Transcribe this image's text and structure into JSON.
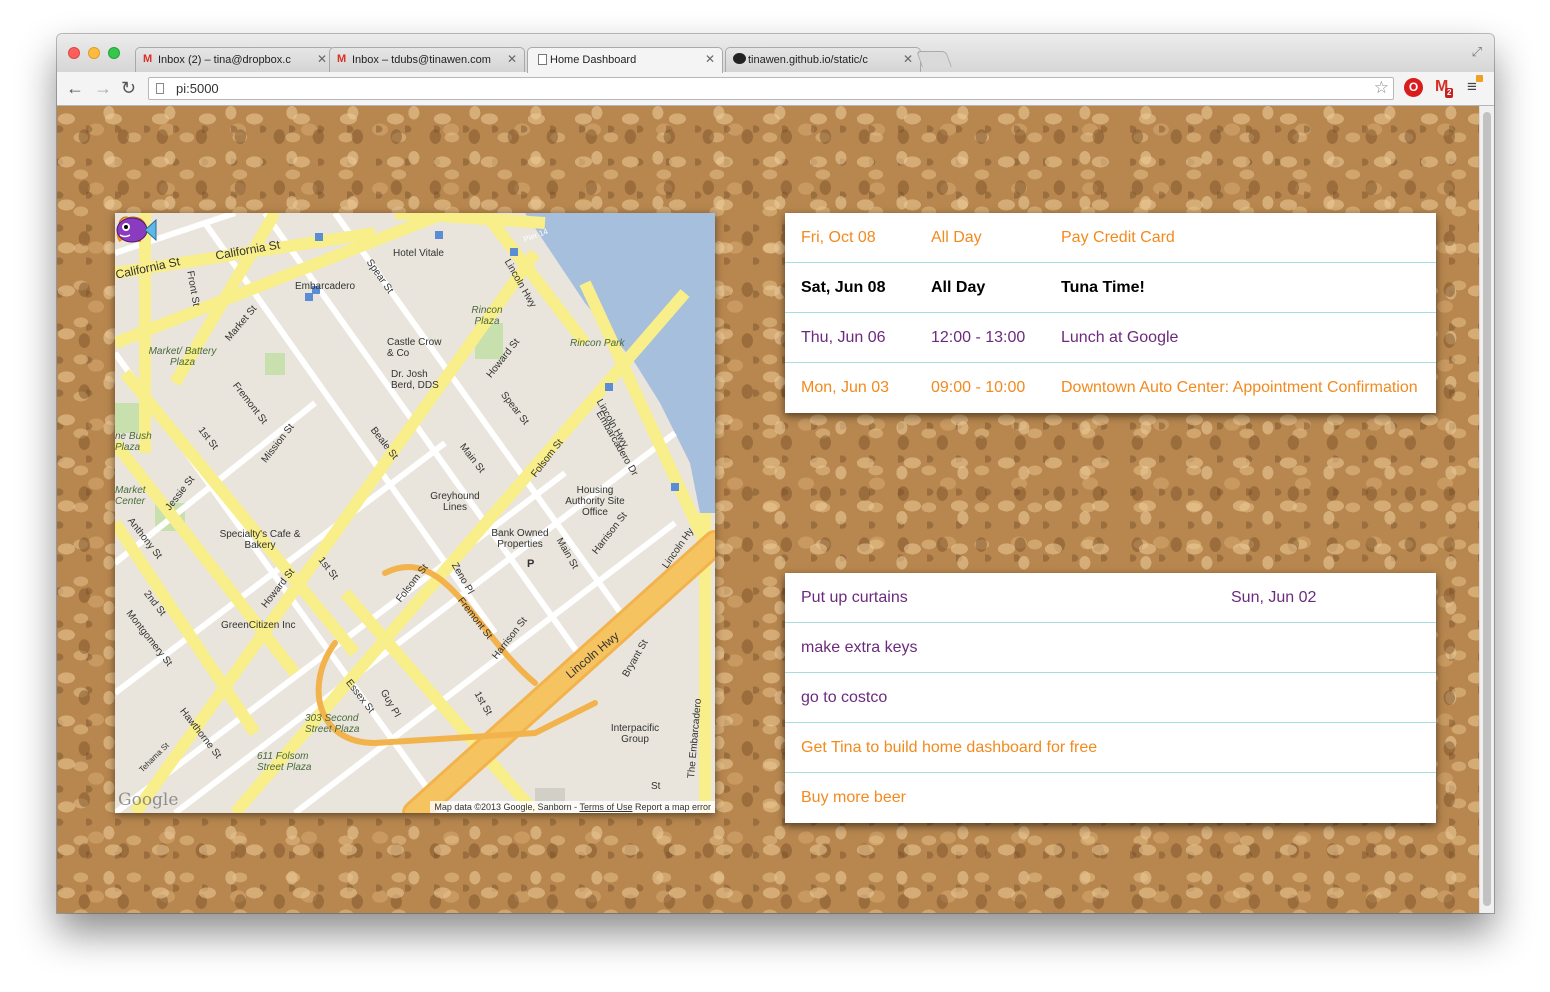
{
  "browser": {
    "tabs": [
      {
        "label": "Inbox (2) – tina@dropbox.c",
        "icon": "gmail-icon"
      },
      {
        "label": "Inbox – tdubs@tinawen.com",
        "icon": "gmail-icon"
      },
      {
        "label": "Home Dashboard",
        "icon": "page-icon",
        "active": true
      },
      {
        "label": "tinawen.github.io/static/c",
        "icon": "github-icon"
      }
    ],
    "url": "pi:5000",
    "gmail_badge": "2",
    "opera_icon_glyph": "O",
    "gmail_icon_glyph": "M"
  },
  "map": {
    "street_labels": {
      "california_st_a": "California St",
      "california_st_b": "California St",
      "front_st": "Front St",
      "market_st": "Market St",
      "spear_st": "Spear St",
      "spear_st_2": "Spear St",
      "lincoln_hwy": "Lincoln Hwy",
      "hotel_vitale": "Hotel Vitale",
      "embarcadero": "Embarcadero",
      "rincon_plaza": "Rincon Plaza",
      "rincon_park": "Rincon Park",
      "market_battery": "Market/ Battery Plaza",
      "fremont_st": "Fremont St",
      "fremont_st_2": "Fremont St",
      "first_st": "1st St",
      "first_st_2": "1st St",
      "first_st_3": "1st St",
      "mission_st": "Mission St",
      "beale_st": "Beale St",
      "main_st": "Main St",
      "main_st_2": "Main St",
      "howard_st": "Howard St",
      "howard_st_2": "Howard St",
      "folsom_st": "Folsom St",
      "folsom_st_2": "Folsom St",
      "lincoln_hwy_2": "Lincoln Hwy",
      "lincoln_hwy_3": "Lincoln Hwy",
      "lincoln_hy": "Lincoln Hy",
      "embarcadero_dr": "Embarcadero Dr",
      "castle": "Castle Crow & Co",
      "josh": "Dr. Josh Berd, DDS",
      "bush_plaza": "ne Bush Plaza",
      "market_center": "Market Center",
      "jessie_st": "Jessie St",
      "anthony_st": "Anthony St",
      "greyhound": "Greyhound Lines",
      "housing": "Housing Authority Site Office",
      "specialty": "Specialty's Cafe & Bakery",
      "bank_owned": "Bank Owned Properties",
      "zeno_pl": "Zeno Pl",
      "harrison_st": "Harrison St",
      "harrison_st_2": "Harrison St",
      "second_st": "2nd St",
      "montgomery_st": "Montgomery St",
      "greencitizen": "GreenCitizen Inc",
      "essex_st": "Essex St",
      "guy_pl": "Guy Pl",
      "bryant_st": "Bryant St",
      "interpacific": "Interpacific Group",
      "hawthorne_st": "Hawthorne St",
      "tehama_st": "Tehama St",
      "second_plaza": "303 Second Street Plaza",
      "folsom_plaza": "611 Folsom Street Plaza",
      "the_embarcadero": "The Embarcadero",
      "pier14": "Pier 14",
      "st": "St",
      "p": "P"
    },
    "attribution": "Map data ©2013 Google, Sanborn",
    "terms": "Terms of Use",
    "report": "Report a map error",
    "google_logo": "Google"
  },
  "events": [
    {
      "date": "Fri, Oct 08",
      "time": "All Day",
      "title": "Pay Credit Card",
      "style": "orange"
    },
    {
      "date": "Sat, Jun 08",
      "time": "All Day",
      "title": "Tuna Time!",
      "style": "bold"
    },
    {
      "date": "Thu, Jun 06",
      "time": "12:00 - 13:00",
      "title": "Lunch at Google",
      "style": "purple"
    },
    {
      "date": "Mon, Jun 03",
      "time": "09:00 - 10:00",
      "title": "Downtown Auto Center: Appointment Confirmation",
      "style": "orange"
    }
  ],
  "todos": [
    {
      "title": "Put up curtains",
      "due": "Sun, Jun 02",
      "style": "purple"
    },
    {
      "title": "make extra keys",
      "due": "",
      "style": "purple"
    },
    {
      "title": "go to costco",
      "due": "",
      "style": "purple"
    },
    {
      "title": "Get Tina to build home dashboard for free",
      "due": "",
      "style": "orange"
    },
    {
      "title": "Buy more beer",
      "due": "",
      "style": "orange"
    }
  ],
  "colors": {
    "orange": "#f28a1e",
    "purple": "#6c2a7d",
    "divider": "#a9dedf",
    "cork": "#b8874f"
  }
}
